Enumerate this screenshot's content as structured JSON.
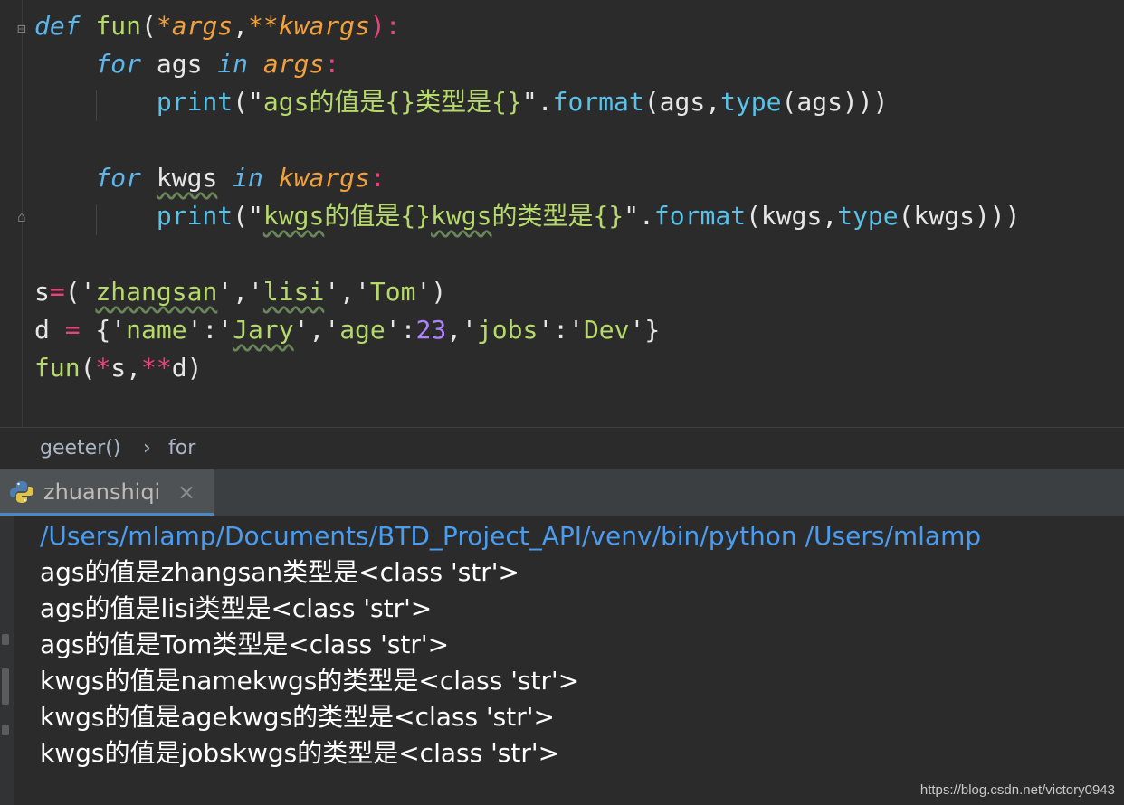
{
  "editor": {
    "lines": [
      {
        "tokens": [
          [
            "def",
            "kw"
          ],
          [
            " ",
            "plain"
          ],
          [
            "fun",
            "fn"
          ],
          [
            "(",
            "plain"
          ],
          [
            "*args",
            "param"
          ],
          [
            ",",
            "plain"
          ],
          [
            "**kwargs",
            "param"
          ],
          [
            "):",
            "op"
          ]
        ]
      },
      {
        "tokens": [
          [
            "    ",
            "plain"
          ],
          [
            "for",
            "kw"
          ],
          [
            " ags ",
            "plain"
          ],
          [
            "in",
            "kw"
          ],
          [
            " ",
            "plain"
          ],
          [
            "args",
            "param"
          ],
          [
            ":",
            "op"
          ]
        ]
      },
      {
        "tokens": [
          [
            "        ",
            "plain"
          ],
          [
            "print",
            "bi"
          ],
          [
            "(\"",
            "plain"
          ],
          [
            "ags的值是{}类型是{}",
            "str"
          ],
          [
            "\".",
            "plain"
          ],
          [
            "format",
            "bi"
          ],
          [
            "(ags,",
            "plain"
          ],
          [
            "type",
            "bi"
          ],
          [
            "(ags)))",
            "plain"
          ]
        ]
      },
      {
        "tokens": []
      },
      {
        "tokens": [
          [
            "    ",
            "plain"
          ],
          [
            "for",
            "kw"
          ],
          [
            " ",
            "plain"
          ],
          [
            "kwgs",
            "plain sq"
          ],
          [
            " ",
            "plain"
          ],
          [
            "in",
            "kw"
          ],
          [
            " ",
            "plain"
          ],
          [
            "kwargs",
            "param"
          ],
          [
            ":",
            "op"
          ]
        ]
      },
      {
        "tokens": [
          [
            "        ",
            "plain"
          ],
          [
            "print",
            "bi"
          ],
          [
            "(\"",
            "plain"
          ],
          [
            "kwgs",
            "str sq"
          ],
          [
            "的值是{}",
            "str"
          ],
          [
            "kwgs",
            "str sq"
          ],
          [
            "的类型是{}",
            "str"
          ],
          [
            "\".",
            "plain"
          ],
          [
            "format",
            "bi"
          ],
          [
            "(kwgs,",
            "plain"
          ],
          [
            "type",
            "bi"
          ],
          [
            "(kwgs)))",
            "plain"
          ]
        ]
      },
      {
        "tokens": []
      },
      {
        "tokens": [
          [
            "s",
            "plain"
          ],
          [
            "=",
            "op"
          ],
          [
            "('",
            "plain"
          ],
          [
            "zhangsan",
            "str sq"
          ],
          [
            "','",
            "plain"
          ],
          [
            "lisi",
            "str sq"
          ],
          [
            "','",
            "plain"
          ],
          [
            "Tom",
            "str"
          ],
          [
            "')",
            "plain"
          ]
        ]
      },
      {
        "tokens": [
          [
            "d ",
            "plain"
          ],
          [
            "=",
            "op"
          ],
          [
            " {'",
            "plain"
          ],
          [
            "name",
            "str"
          ],
          [
            "':'",
            "plain"
          ],
          [
            "Jary",
            "str sq"
          ],
          [
            "','",
            "plain"
          ],
          [
            "age",
            "str"
          ],
          [
            "':",
            "plain"
          ],
          [
            "23",
            "num"
          ],
          [
            ",'",
            "plain"
          ],
          [
            "jobs",
            "str"
          ],
          [
            "':'",
            "plain"
          ],
          [
            "Dev",
            "str"
          ],
          [
            "'}",
            "plain"
          ]
        ]
      },
      {
        "tokens": [
          [
            "fun",
            "fn"
          ],
          [
            "(",
            "plain"
          ],
          [
            "*",
            "op"
          ],
          [
            "s,",
            "plain"
          ],
          [
            "**",
            "op"
          ],
          [
            "d)",
            "plain"
          ]
        ]
      }
    ]
  },
  "breadcrumb": {
    "func": "geeter()",
    "sep": "›",
    "item": "for"
  },
  "run_tab": {
    "label": "zhuanshiqi",
    "close": "×",
    "icon": "python-icon"
  },
  "console": {
    "lines": [
      "/Users/mlamp/Documents/BTD_Project_API/venv/bin/python /Users/mlamp",
      "ags的值是zhangsan类型是<class 'str'>",
      "ags的值是lisi类型是<class 'str'>",
      "ags的值是Tom类型是<class 'str'>",
      "kwgs的值是namekwgs的类型是<class 'str'>",
      "kwgs的值是agekwgs的类型是<class 'str'>",
      "kwgs的值是jobskwgs的类型是<class 'str'>"
    ]
  },
  "watermark": "https://blog.csdn.net/victory0943"
}
